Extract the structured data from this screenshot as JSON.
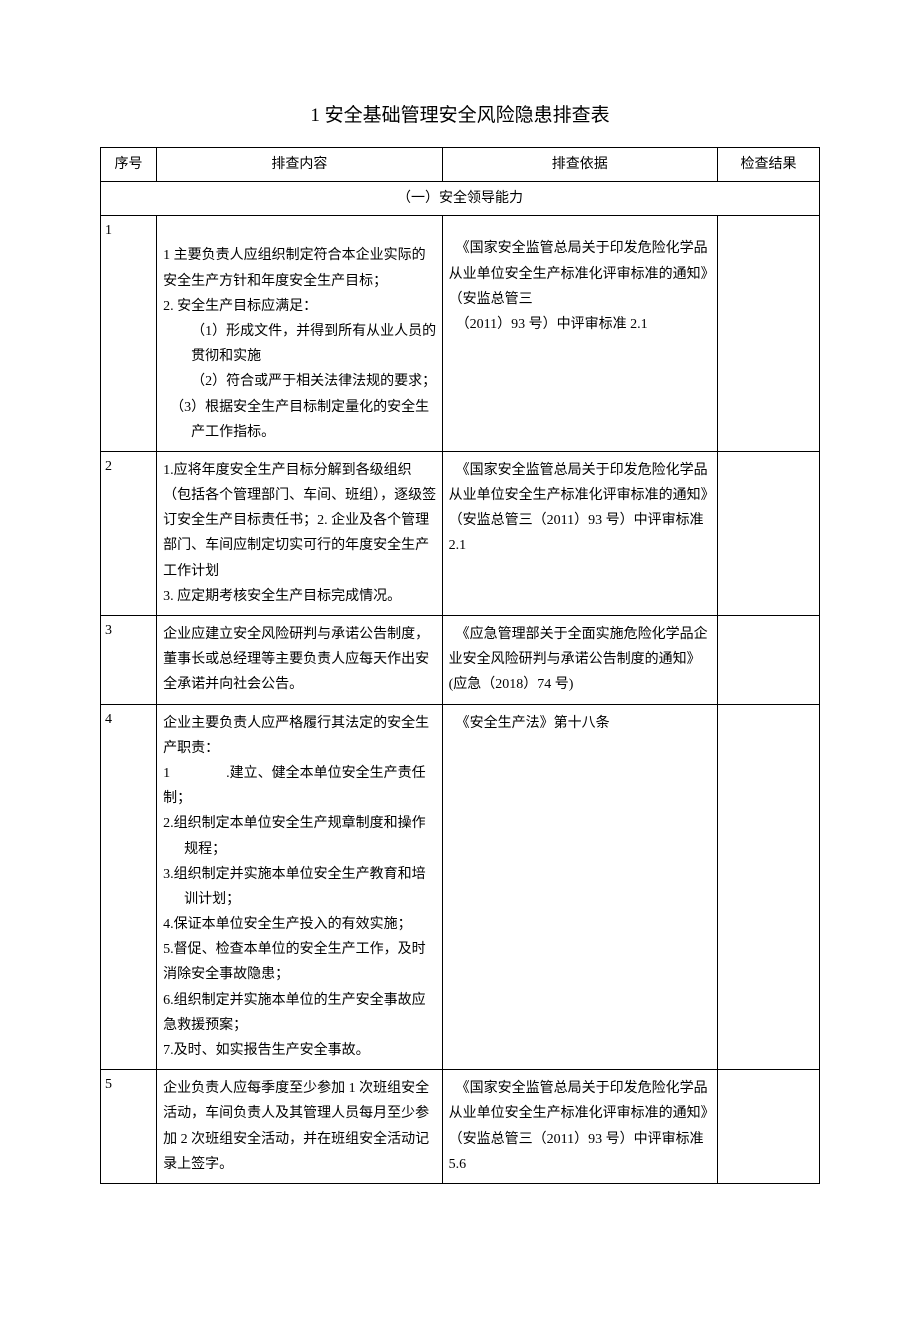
{
  "title": "1 安全基础管理安全风险隐患排查表",
  "headers": {
    "seq": "序号",
    "content": "排查内容",
    "basis": "排查依据",
    "result": "检查结果"
  },
  "section_title": "（一）安全领导能力",
  "rows": {
    "r1": {
      "seq": "1",
      "content_l1": "1 主要负责人应组织制定符合本企业实际的安全生产方针和年度安全生产目标；",
      "content_l2": "2. 安全生产目标应满足：",
      "content_l3": "（1）形成文件，并得到所有从业人员的贯彻和实施",
      "content_l4": "（2）符合或严于相关法律法规的要求；",
      "content_l5": "（3）根据安全生产目标制定量化的安全生产工作指标。",
      "basis_l1": "《国家安全监管总局关于印发危险化学品从业单位安全生产标准化评审标准的通知》（安监总管三",
      "basis_l2": "（2011）93 号）中评审标准 2.1"
    },
    "r2": {
      "seq": "2",
      "content_l1": "1.应将年度安全生产目标分解到各级组织（包括各个管理部门、车间、班组），逐级签订安全生产目标责任书；2. 企业及各个管理部门、车间应制定切实可行的年度安全生产工作计划",
      "content_l2": "3. 应定期考核安全生产目标完成情况。",
      "basis": "《国家安全监管总局关于印发危险化学品从业单位安全生产标准化评审标准的通知》（安监总管三（2011）93 号）中评审标准 2.1"
    },
    "r3": {
      "seq": "3",
      "content": "企业应建立安全风险研判与承诺公告制度，董事长或总经理等主要负责人应每天作出安全承诺并向社会公告。",
      "basis_l1": "《应急管理部关于全面实施危险化学品企业安全风险研判与承诺公告制度的通知》",
      "basis_l2": "(应急（2018）74 号)"
    },
    "r4": {
      "seq": "4",
      "content_l0": "企业主要负责人应严格履行其法定的安全生产职责：",
      "content_l1": "1　　　　.建立、健全本单位安全生产责任制；",
      "content_l2": "2.组织制定本单位安全生产规章制度和操作规程；",
      "content_l3": "3.组织制定并实施本单位安全生产教育和培训计划；",
      "content_l4": "4.保证本单位安全生产投入的有效实施；",
      "content_l5": "5.督促、检查本单位的安全生产工作，及时消除安全事故隐患；",
      "content_l6": "6.组织制定并实施本单位的生产安全事故应急救援预案；",
      "content_l7": "7.及时、如实报告生产安全事故。",
      "basis": "《安全生产法》第十八条"
    },
    "r5": {
      "seq": "5",
      "content": "企业负责人应每季度至少参加 1 次班组安全活动，车间负责人及其管理人员每月至少参加 2 次班组安全活动，并在班组安全活动记录上签字。",
      "basis": "《国家安全监管总局关于印发危险化学品从业单位安全生产标准化评审标准的通知》（安监总管三（2011）93 号）中评审标准 5.6"
    }
  }
}
